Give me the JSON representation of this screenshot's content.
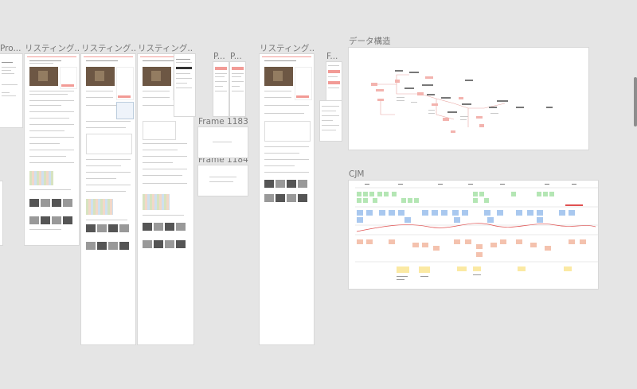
{
  "frames": {
    "pro": "Pro...",
    "listing1": "リスティング...",
    "listing2": "リスティング...",
    "listing3": "リスティング...",
    "p1": "P...",
    "p2": "P...",
    "listing4": "リスティング...",
    "f": "F...",
    "frame1183": "Frame 1183",
    "frame1184": "Frame 1184",
    "data_structure": "データ構造",
    "cjm": "CJM"
  },
  "colors": {
    "canvas_bg": "#e5e5e5",
    "frame_bg": "#ffffff",
    "accent_pink": "#f29b96",
    "sticky_green": "#b4e6b4",
    "sticky_blue": "#a9c8ef",
    "sticky_salmon": "#f4c2ae",
    "sticky_yellow": "#fbe9a3",
    "cjm_red": "#e05050"
  }
}
